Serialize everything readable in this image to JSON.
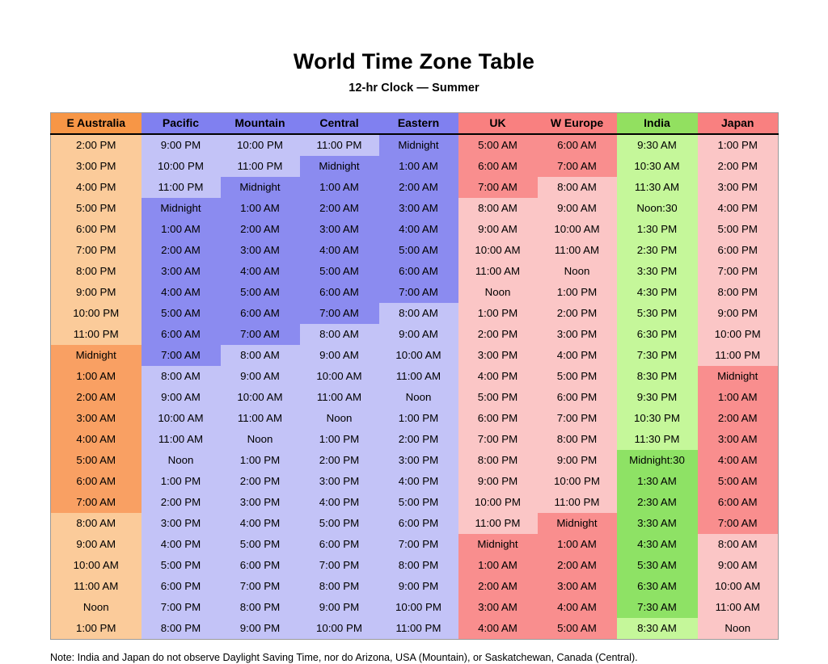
{
  "document": {
    "title": "World Time Zone Table",
    "subtitle": "12-hr Clock — Summer",
    "note": "Note: India and Japan do not observe Daylight Saving Time, nor do Arizona, USA (Mountain), or Saskatchewan, Canada (Central)."
  },
  "palette": {
    "orange_dark": "#f9a063",
    "orange_light": "#fbcb9a",
    "blue_dark": "#8b8bf0",
    "blue_light": "#c3c3f7",
    "red_dark": "#f98e8e",
    "red_light": "#fbc6c6",
    "green_dark": "#8ee265",
    "green_light": "#c5f79a",
    "header_border": "#000000"
  },
  "table": {
    "columns": [
      {
        "label": "E Australia",
        "header_color": "#f79646",
        "tone_dark": "#f9a063",
        "tone_light": "#fbcb9a"
      },
      {
        "label": "Pacific",
        "header_color": "#8080f0",
        "tone_dark": "#8b8bf0",
        "tone_light": "#c3c3f7"
      },
      {
        "label": "Mountain",
        "header_color": "#8080f0",
        "tone_dark": "#8b8bf0",
        "tone_light": "#c3c3f7"
      },
      {
        "label": "Central",
        "header_color": "#8080f0",
        "tone_dark": "#8b8bf0",
        "tone_light": "#c3c3f7"
      },
      {
        "label": "Eastern",
        "header_color": "#8080f0",
        "tone_dark": "#8b8bf0",
        "tone_light": "#c3c3f7"
      },
      {
        "label": "UK",
        "header_color": "#f98080",
        "tone_dark": "#f98e8e",
        "tone_light": "#fbc6c6"
      },
      {
        "label": "W Europe",
        "header_color": "#f98080",
        "tone_dark": "#f98e8e",
        "tone_light": "#fbc6c6"
      },
      {
        "label": "India",
        "header_color": "#92e060",
        "tone_dark": "#8ee265",
        "tone_light": "#c5f79a"
      },
      {
        "label": "Japan",
        "header_color": "#f98080",
        "tone_dark": "#f98e8e",
        "tone_light": "#fbc6c6"
      }
    ],
    "rows": [
      {
        "cells": [
          "2:00 PM",
          "9:00 PM",
          "10:00 PM",
          "11:00 PM",
          "Midnight",
          "5:00 AM",
          "6:00 AM",
          "9:30 AM",
          "1:00 PM"
        ],
        "shade": [
          "light",
          "light",
          "light",
          "light",
          "dark",
          "dark",
          "dark",
          "light",
          "light"
        ]
      },
      {
        "cells": [
          "3:00 PM",
          "10:00 PM",
          "11:00 PM",
          "Midnight",
          "1:00 AM",
          "6:00 AM",
          "7:00 AM",
          "10:30 AM",
          "2:00 PM"
        ],
        "shade": [
          "light",
          "light",
          "light",
          "dark",
          "dark",
          "dark",
          "dark",
          "light",
          "light"
        ]
      },
      {
        "cells": [
          "4:00 PM",
          "11:00 PM",
          "Midnight",
          "1:00 AM",
          "2:00 AM",
          "7:00 AM",
          "8:00 AM",
          "11:30 AM",
          "3:00 PM"
        ],
        "shade": [
          "light",
          "light",
          "dark",
          "dark",
          "dark",
          "dark",
          "light",
          "light",
          "light"
        ]
      },
      {
        "cells": [
          "5:00 PM",
          "Midnight",
          "1:00 AM",
          "2:00 AM",
          "3:00 AM",
          "8:00 AM",
          "9:00 AM",
          "Noon:30",
          "4:00 PM"
        ],
        "shade": [
          "light",
          "dark",
          "dark",
          "dark",
          "dark",
          "light",
          "light",
          "light",
          "light"
        ]
      },
      {
        "cells": [
          "6:00 PM",
          "1:00 AM",
          "2:00 AM",
          "3:00 AM",
          "4:00 AM",
          "9:00 AM",
          "10:00 AM",
          "1:30 PM",
          "5:00 PM"
        ],
        "shade": [
          "light",
          "dark",
          "dark",
          "dark",
          "dark",
          "light",
          "light",
          "light",
          "light"
        ]
      },
      {
        "cells": [
          "7:00 PM",
          "2:00 AM",
          "3:00 AM",
          "4:00 AM",
          "5:00 AM",
          "10:00 AM",
          "11:00 AM",
          "2:30 PM",
          "6:00 PM"
        ],
        "shade": [
          "light",
          "dark",
          "dark",
          "dark",
          "dark",
          "light",
          "light",
          "light",
          "light"
        ]
      },
      {
        "cells": [
          "8:00 PM",
          "3:00 AM",
          "4:00 AM",
          "5:00 AM",
          "6:00 AM",
          "11:00 AM",
          "Noon",
          "3:30 PM",
          "7:00 PM"
        ],
        "shade": [
          "light",
          "dark",
          "dark",
          "dark",
          "dark",
          "light",
          "light",
          "light",
          "light"
        ]
      },
      {
        "cells": [
          "9:00 PM",
          "4:00 AM",
          "5:00 AM",
          "6:00 AM",
          "7:00 AM",
          "Noon",
          "1:00 PM",
          "4:30 PM",
          "8:00 PM"
        ],
        "shade": [
          "light",
          "dark",
          "dark",
          "dark",
          "dark",
          "light",
          "light",
          "light",
          "light"
        ]
      },
      {
        "cells": [
          "10:00 PM",
          "5:00 AM",
          "6:00 AM",
          "7:00 AM",
          "8:00 AM",
          "1:00 PM",
          "2:00 PM",
          "5:30 PM",
          "9:00 PM"
        ],
        "shade": [
          "light",
          "dark",
          "dark",
          "dark",
          "light",
          "light",
          "light",
          "light",
          "light"
        ]
      },
      {
        "cells": [
          "11:00 PM",
          "6:00 AM",
          "7:00 AM",
          "8:00 AM",
          "9:00 AM",
          "2:00 PM",
          "3:00 PM",
          "6:30 PM",
          "10:00 PM"
        ],
        "shade": [
          "light",
          "dark",
          "dark",
          "light",
          "light",
          "light",
          "light",
          "light",
          "light"
        ]
      },
      {
        "cells": [
          "Midnight",
          "7:00 AM",
          "8:00 AM",
          "9:00 AM",
          "10:00 AM",
          "3:00 PM",
          "4:00 PM",
          "7:30 PM",
          "11:00 PM"
        ],
        "shade": [
          "dark",
          "dark",
          "light",
          "light",
          "light",
          "light",
          "light",
          "light",
          "light"
        ]
      },
      {
        "cells": [
          "1:00 AM",
          "8:00 AM",
          "9:00 AM",
          "10:00 AM",
          "11:00 AM",
          "4:00 PM",
          "5:00 PM",
          "8:30 PM",
          "Midnight"
        ],
        "shade": [
          "dark",
          "light",
          "light",
          "light",
          "light",
          "light",
          "light",
          "light",
          "dark"
        ]
      },
      {
        "cells": [
          "2:00 AM",
          "9:00 AM",
          "10:00 AM",
          "11:00 AM",
          "Noon",
          "5:00 PM",
          "6:00 PM",
          "9:30 PM",
          "1:00 AM"
        ],
        "shade": [
          "dark",
          "light",
          "light",
          "light",
          "light",
          "light",
          "light",
          "light",
          "dark"
        ]
      },
      {
        "cells": [
          "3:00 AM",
          "10:00 AM",
          "11:00 AM",
          "Noon",
          "1:00 PM",
          "6:00 PM",
          "7:00 PM",
          "10:30 PM",
          "2:00 AM"
        ],
        "shade": [
          "dark",
          "light",
          "light",
          "light",
          "light",
          "light",
          "light",
          "light",
          "dark"
        ]
      },
      {
        "cells": [
          "4:00 AM",
          "11:00 AM",
          "Noon",
          "1:00 PM",
          "2:00 PM",
          "7:00 PM",
          "8:00 PM",
          "11:30 PM",
          "3:00 AM"
        ],
        "shade": [
          "dark",
          "light",
          "light",
          "light",
          "light",
          "light",
          "light",
          "light",
          "dark"
        ]
      },
      {
        "cells": [
          "5:00 AM",
          "Noon",
          "1:00 PM",
          "2:00 PM",
          "3:00 PM",
          "8:00 PM",
          "9:00 PM",
          "Midnight:30",
          "4:00 AM"
        ],
        "shade": [
          "dark",
          "light",
          "light",
          "light",
          "light",
          "light",
          "light",
          "dark",
          "dark"
        ]
      },
      {
        "cells": [
          "6:00 AM",
          "1:00 PM",
          "2:00 PM",
          "3:00 PM",
          "4:00 PM",
          "9:00 PM",
          "10:00 PM",
          "1:30 AM",
          "5:00 AM"
        ],
        "shade": [
          "dark",
          "light",
          "light",
          "light",
          "light",
          "light",
          "light",
          "dark",
          "dark"
        ]
      },
      {
        "cells": [
          "7:00 AM",
          "2:00 PM",
          "3:00 PM",
          "4:00 PM",
          "5:00 PM",
          "10:00 PM",
          "11:00 PM",
          "2:30 AM",
          "6:00 AM"
        ],
        "shade": [
          "dark",
          "light",
          "light",
          "light",
          "light",
          "light",
          "light",
          "dark",
          "dark"
        ]
      },
      {
        "cells": [
          "8:00 AM",
          "3:00 PM",
          "4:00 PM",
          "5:00 PM",
          "6:00 PM",
          "11:00 PM",
          "Midnight",
          "3:30 AM",
          "7:00 AM"
        ],
        "shade": [
          "light",
          "light",
          "light",
          "light",
          "light",
          "light",
          "dark",
          "dark",
          "dark"
        ]
      },
      {
        "cells": [
          "9:00 AM",
          "4:00 PM",
          "5:00 PM",
          "6:00 PM",
          "7:00 PM",
          "Midnight",
          "1:00 AM",
          "4:30 AM",
          "8:00 AM"
        ],
        "shade": [
          "light",
          "light",
          "light",
          "light",
          "light",
          "dark",
          "dark",
          "dark",
          "light"
        ]
      },
      {
        "cells": [
          "10:00 AM",
          "5:00 PM",
          "6:00 PM",
          "7:00 PM",
          "8:00 PM",
          "1:00 AM",
          "2:00 AM",
          "5:30 AM",
          "9:00 AM"
        ],
        "shade": [
          "light",
          "light",
          "light",
          "light",
          "light",
          "dark",
          "dark",
          "dark",
          "light"
        ]
      },
      {
        "cells": [
          "11:00 AM",
          "6:00 PM",
          "7:00 PM",
          "8:00 PM",
          "9:00 PM",
          "2:00 AM",
          "3:00 AM",
          "6:30 AM",
          "10:00 AM"
        ],
        "shade": [
          "light",
          "light",
          "light",
          "light",
          "light",
          "dark",
          "dark",
          "dark",
          "light"
        ]
      },
      {
        "cells": [
          "Noon",
          "7:00 PM",
          "8:00 PM",
          "9:00 PM",
          "10:00 PM",
          "3:00 AM",
          "4:00 AM",
          "7:30 AM",
          "11:00 AM"
        ],
        "shade": [
          "light",
          "light",
          "light",
          "light",
          "light",
          "dark",
          "dark",
          "dark",
          "light"
        ]
      },
      {
        "cells": [
          "1:00 PM",
          "8:00 PM",
          "9:00 PM",
          "10:00 PM",
          "11:00 PM",
          "4:00 AM",
          "5:00 AM",
          "8:30 AM",
          "Noon"
        ],
        "shade": [
          "light",
          "light",
          "light",
          "light",
          "light",
          "dark",
          "dark",
          "light",
          "light"
        ]
      }
    ]
  }
}
